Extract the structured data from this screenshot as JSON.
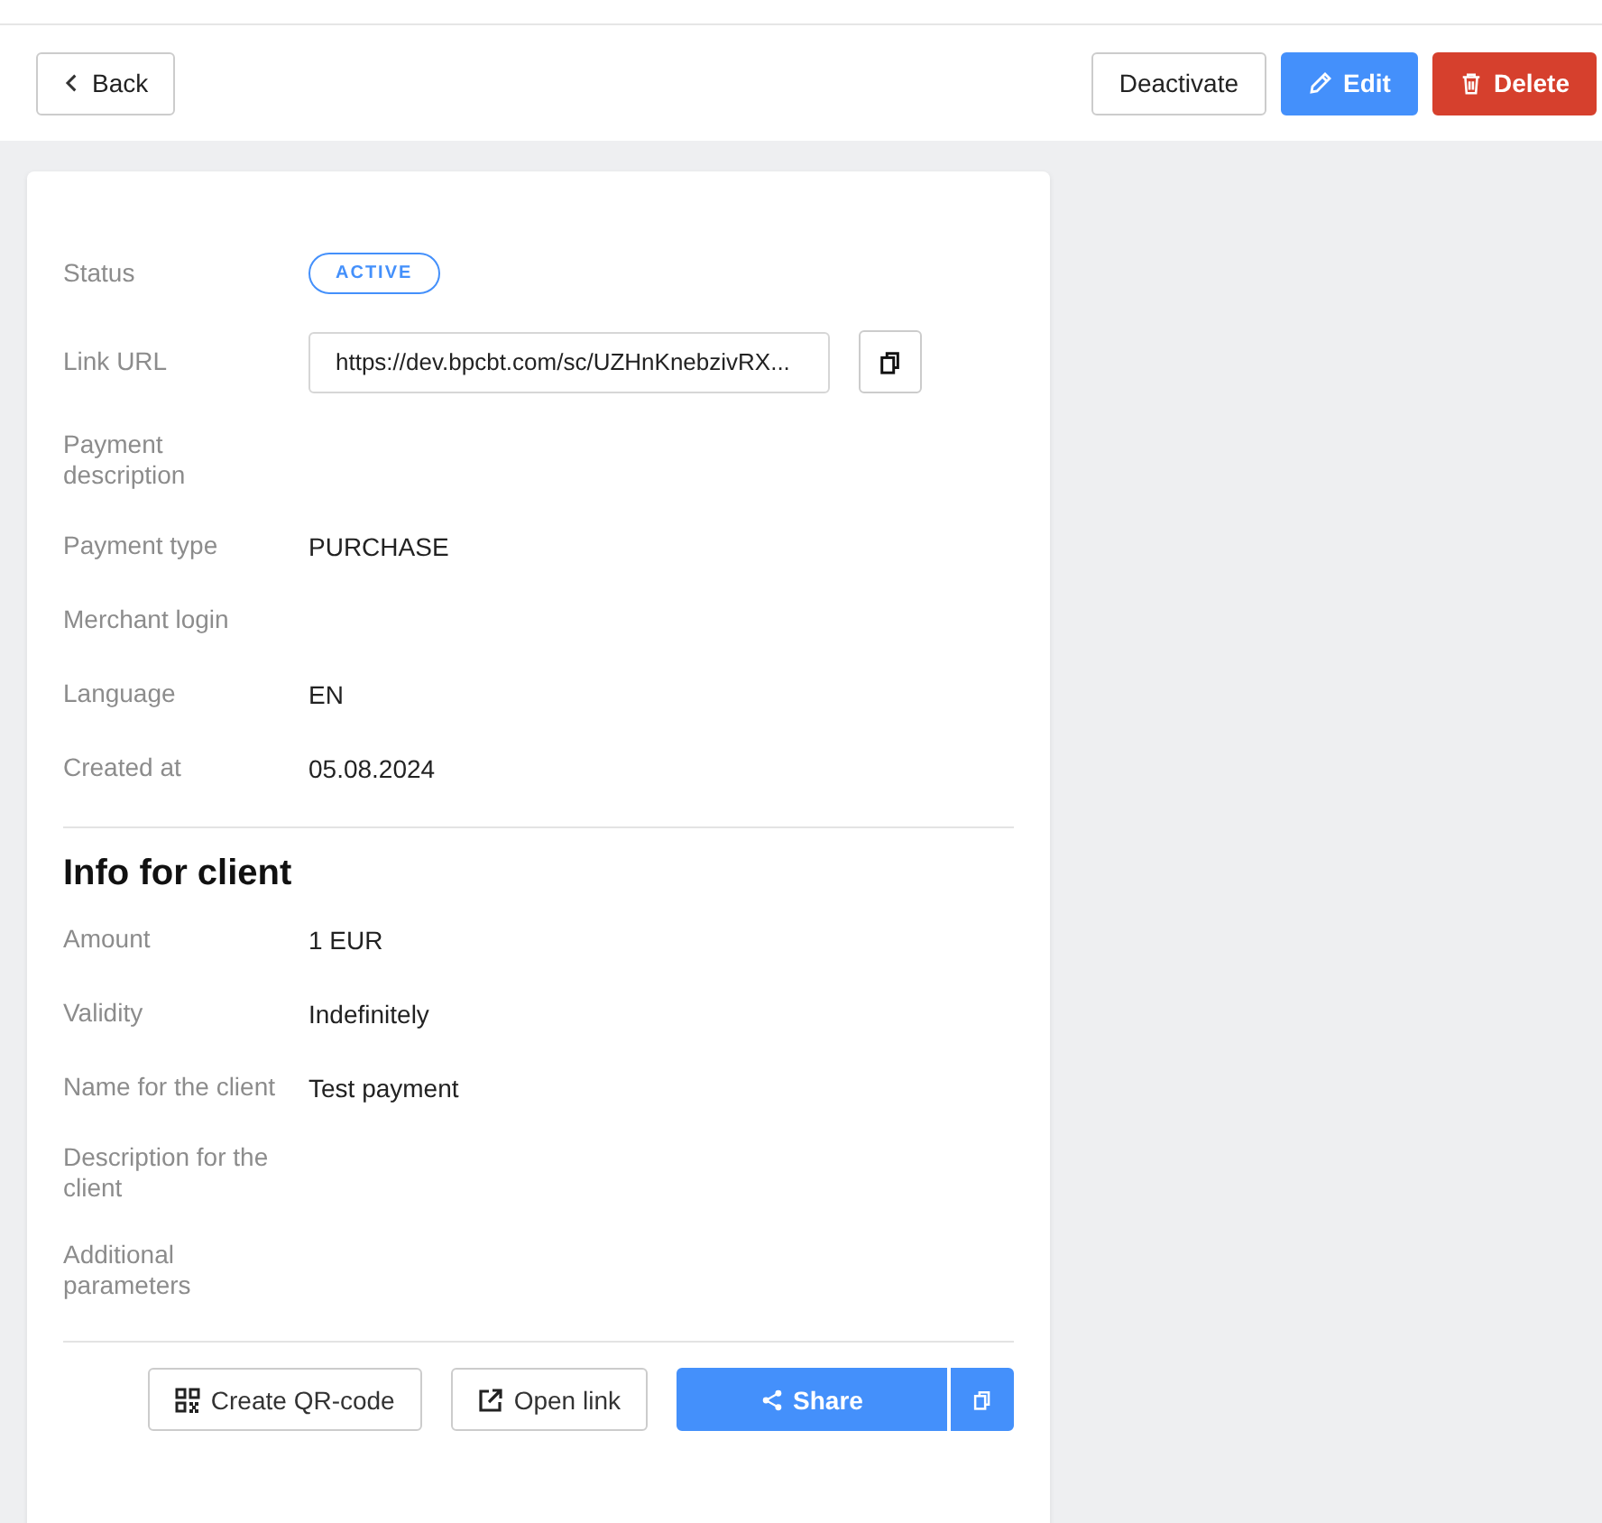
{
  "toolbar": {
    "back": "Back",
    "deactivate": "Deactivate",
    "edit": "Edit",
    "delete": "Delete"
  },
  "details": [
    {
      "kind": "badge",
      "label": "Status",
      "value": "ACTIVE"
    },
    {
      "kind": "link",
      "label": "Link URL",
      "value": "https://dev.bpcbt.com/sc/UZHnKnebzivRX..."
    },
    {
      "kind": "text",
      "label": "Payment description"
    },
    {
      "kind": "text",
      "label": "Payment type",
      "value": "PURCHASE"
    },
    {
      "kind": "text",
      "label": "Merchant login"
    },
    {
      "kind": "text",
      "label": "Language",
      "value": "EN"
    },
    {
      "kind": "text",
      "label": "Created at",
      "value": "05.08.2024"
    }
  ],
  "client_section": {
    "title": "Info for client",
    "rows": [
      {
        "kind": "text",
        "label": "Amount",
        "value": "1 EUR"
      },
      {
        "kind": "text",
        "label": "Validity",
        "value": "Indefinitely"
      },
      {
        "kind": "text",
        "label": "Name for the client",
        "value": "Test payment"
      },
      {
        "kind": "text",
        "label": "Description for the client"
      },
      {
        "kind": "text",
        "label": "Additional parameters"
      }
    ]
  },
  "actions": {
    "qr": "Create QR-code",
    "open": "Open link",
    "share": "Share"
  }
}
